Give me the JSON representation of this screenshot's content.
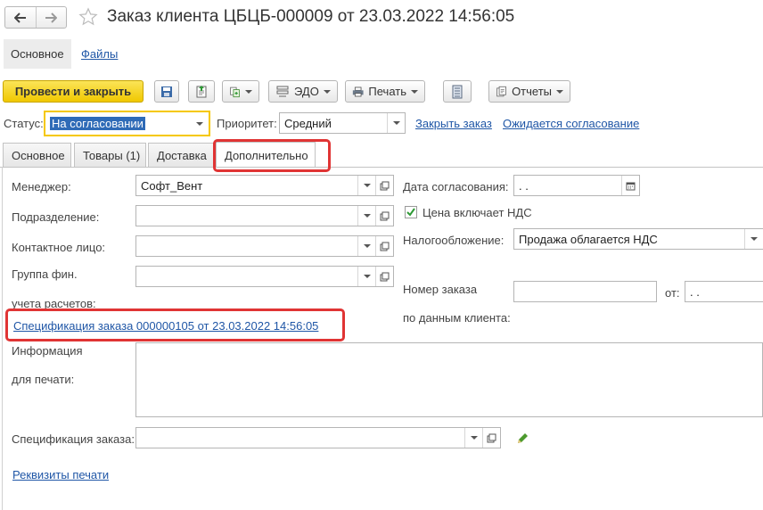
{
  "header": {
    "title": "Заказ клиента ЦБЦБ-000009 от 23.03.2022 14:56:05"
  },
  "subtabs": [
    {
      "label": "Основное"
    },
    {
      "label": "Файлы"
    }
  ],
  "toolbar": {
    "post_close": "Провести и закрыть",
    "edo": "ЭДО",
    "print": "Печать",
    "reports": "Отчеты"
  },
  "status_row": {
    "status_label": "Статус:",
    "status_value": "На согласовании",
    "priority_label": "Приоритет:",
    "priority_value": "Средний",
    "close_order": "Закрыть заказ",
    "awaiting": "Ожидается согласование"
  },
  "tabs": [
    {
      "label": "Основное"
    },
    {
      "label": "Товары (1)"
    },
    {
      "label": "Доставка"
    },
    {
      "label": "Дополнительно"
    }
  ],
  "form": {
    "manager_label": "Менеджер:",
    "manager_value": "Софт_Вент",
    "division_label": "Подразделение:",
    "division_value": "",
    "contact_label": "Контактное лицо:",
    "contact_value": "",
    "fin_group_label_1": "Группа фин.",
    "fin_group_label_2": "учета расчетов:",
    "fin_group_value": "",
    "spec_link": "Спецификация заказа 000000105 от 23.03.2022 14:56:05",
    "info_label_1": "Информация",
    "info_label_2": "для печати:",
    "info_value": "",
    "spec_label": "Спецификация заказа:",
    "spec_value": "",
    "print_details": "Реквизиты печати",
    "approval_date_label": "Дата согласования:",
    "approval_date_value": " .  .",
    "vat_included_label": "Цена включает НДС",
    "vat_included_checked": true,
    "taxation_label": "Налогообложение:",
    "taxation_value": "Продажа облагается НДС",
    "order_number_label_1": "Номер заказа",
    "order_number_label_2": "по данным клиента:",
    "order_number_value": "",
    "from_label": "от:",
    "from_value": " .  ."
  },
  "colors": {
    "accent_yellow": "#f5d11c",
    "link_blue": "#1f56a6",
    "highlight_red": "#e03434"
  }
}
